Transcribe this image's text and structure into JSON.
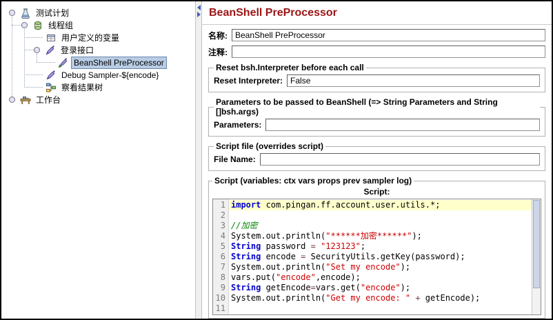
{
  "colors": {
    "panel_title": "#9a1515",
    "selection_bg": "#b8cce4",
    "selection_border": "#6b87ad",
    "line_highlight": "#ffffcc",
    "keyword": "#0000cc",
    "datatype": "#0000cc",
    "string": "#cc0000",
    "comment": "#008200",
    "operator": "#7a3e3e"
  },
  "tree": {
    "items": [
      {
        "label": "测试计划",
        "icon": "test-plan-icon",
        "depth": 0,
        "expandable": true,
        "selected": false
      },
      {
        "label": "线程组",
        "icon": "thread-group-icon",
        "depth": 1,
        "expandable": true,
        "selected": false
      },
      {
        "label": "用户定义的变量",
        "icon": "user-defined-variables-icon",
        "depth": 2,
        "expandable": false,
        "selected": false
      },
      {
        "label": "登录接口",
        "icon": "http-sampler-icon",
        "depth": 2,
        "expandable": true,
        "selected": false
      },
      {
        "label": "BeanShell PreProcessor",
        "icon": "beanshell-preprocessor-icon",
        "depth": 3,
        "expandable": false,
        "selected": true
      },
      {
        "label": "Debug Sampler-${encode}",
        "icon": "debug-sampler-icon",
        "depth": 2,
        "expandable": false,
        "selected": false
      },
      {
        "label": "察看结果树",
        "icon": "view-results-tree-icon",
        "depth": 2,
        "expandable": false,
        "selected": false
      },
      {
        "label": "工作台",
        "icon": "workbench-icon",
        "depth": 0,
        "expandable": true,
        "selected": false
      }
    ]
  },
  "panel": {
    "title": "BeanShell PreProcessor",
    "name_label": "名称:",
    "name_value": "BeanShell PreProcessor",
    "comment_label": "注释:",
    "comment_value": "",
    "reset_group": {
      "title": "Reset bsh.Interpreter before each call",
      "label": "Reset Interpreter:",
      "value": "False"
    },
    "params_group": {
      "title": "Parameters to be passed to BeanShell (=> String Parameters and String []bsh.args)",
      "label": "Parameters:",
      "value": ""
    },
    "file_group": {
      "title": "Script file (overrides script)",
      "label": "File Name:",
      "value": ""
    },
    "script_group": {
      "title": "Script (variables: ctx vars props prev sampler log)",
      "label": "Script:"
    }
  },
  "code": {
    "lines": [
      {
        "n": 1,
        "highlight": true,
        "tokens": [
          {
            "s": "kw",
            "t": "import"
          },
          {
            "s": "pl",
            "t": " com.pingan.ff.account.user.utils.*;"
          }
        ]
      },
      {
        "n": 2,
        "tokens": []
      },
      {
        "n": 3,
        "tokens": [
          {
            "s": "cm",
            "t": "//加密"
          }
        ]
      },
      {
        "n": 4,
        "tokens": [
          {
            "s": "pl",
            "t": "System.out.println("
          },
          {
            "s": "st",
            "t": "\"******加密******\""
          },
          {
            "s": "pl",
            "t": ");"
          }
        ]
      },
      {
        "n": 5,
        "tokens": [
          {
            "s": "ty",
            "t": "String"
          },
          {
            "s": "pl",
            "t": " password "
          },
          {
            "s": "op",
            "t": "="
          },
          {
            "s": "pl",
            "t": " "
          },
          {
            "s": "st",
            "t": "\"123123\""
          },
          {
            "s": "pl",
            "t": ";"
          }
        ]
      },
      {
        "n": 6,
        "tokens": [
          {
            "s": "ty",
            "t": "String"
          },
          {
            "s": "pl",
            "t": " encode "
          },
          {
            "s": "op",
            "t": "="
          },
          {
            "s": "pl",
            "t": " SecurityUtils.getKey(password);"
          }
        ]
      },
      {
        "n": 7,
        "tokens": [
          {
            "s": "pl",
            "t": "System.out.println("
          },
          {
            "s": "st",
            "t": "\"Set my encode\""
          },
          {
            "s": "pl",
            "t": ");"
          }
        ]
      },
      {
        "n": 8,
        "tokens": [
          {
            "s": "pl",
            "t": "vars.put("
          },
          {
            "s": "st",
            "t": "\"encode\""
          },
          {
            "s": "pl",
            "t": ",encode);"
          }
        ]
      },
      {
        "n": 9,
        "tokens": [
          {
            "s": "ty",
            "t": "String"
          },
          {
            "s": "pl",
            "t": " getEncode"
          },
          {
            "s": "op",
            "t": "="
          },
          {
            "s": "pl",
            "t": "vars.get("
          },
          {
            "s": "st",
            "t": "\"encode\""
          },
          {
            "s": "pl",
            "t": ");"
          }
        ]
      },
      {
        "n": 10,
        "tokens": [
          {
            "s": "pl",
            "t": "System.out.println("
          },
          {
            "s": "st",
            "t": "\"Get my encode: \""
          },
          {
            "s": "pl",
            "t": " "
          },
          {
            "s": "op",
            "t": "+"
          },
          {
            "s": "pl",
            "t": " getEncode);"
          }
        ]
      },
      {
        "n": 11,
        "tokens": []
      }
    ]
  }
}
